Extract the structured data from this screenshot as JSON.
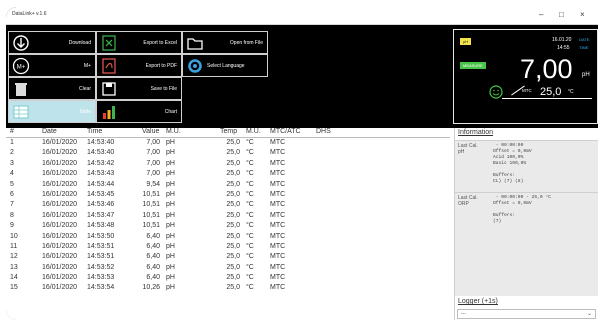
{
  "window": {
    "title": "DataLink+ v.1.6",
    "controls": [
      "–",
      "□",
      "×"
    ]
  },
  "toolbar": {
    "download": "Download",
    "export_excel": "Export to Excel",
    "open_file": "Open from File",
    "mem_plus": "M+",
    "export_pdf": "Export to PDF",
    "select_language": "Select Language",
    "clear": "Clear",
    "save_file": "Save to File",
    "table": "Table",
    "chart": "Chart"
  },
  "display": {
    "mode": "pH",
    "date": "16.01.20",
    "time": "14:55",
    "date_label": "DATE",
    "time_label": "TIME",
    "status": "MEASURE",
    "value": "7,00",
    "unit": "pH",
    "temp_tag": "MTC",
    "temp_value": "25,0",
    "temp_unit": "°C"
  },
  "table": {
    "headers": [
      "#",
      "Date",
      "Time",
      "Value",
      "M.U.",
      "Temp",
      "M.U.",
      "MTC/ATC",
      "DHS"
    ],
    "rows": [
      [
        "1",
        "16/01/2020",
        "14:53:40",
        "7,00",
        "pH",
        "25,0",
        "°C",
        "MTC",
        ""
      ],
      [
        "2",
        "16/01/2020",
        "14:53:40",
        "7,00",
        "pH",
        "25,0",
        "°C",
        "MTC",
        ""
      ],
      [
        "3",
        "16/01/2020",
        "14:53:42",
        "7,00",
        "pH",
        "25,0",
        "°C",
        "MTC",
        ""
      ],
      [
        "4",
        "16/01/2020",
        "14:53:43",
        "7,00",
        "pH",
        "25,0",
        "°C",
        "MTC",
        ""
      ],
      [
        "5",
        "16/01/2020",
        "14:53:44",
        "9,54",
        "pH",
        "25,0",
        "°C",
        "MTC",
        ""
      ],
      [
        "6",
        "16/01/2020",
        "14:53:45",
        "10,51",
        "pH",
        "25,0",
        "°C",
        "MTC",
        ""
      ],
      [
        "7",
        "16/01/2020",
        "14:53:46",
        "10,51",
        "pH",
        "25,0",
        "°C",
        "MTC",
        ""
      ],
      [
        "8",
        "16/01/2020",
        "14:53:47",
        "10,51",
        "pH",
        "25,0",
        "°C",
        "MTC",
        ""
      ],
      [
        "9",
        "16/01/2020",
        "14:53:48",
        "10,51",
        "pH",
        "25,0",
        "°C",
        "MTC",
        ""
      ],
      [
        "10",
        "16/01/2020",
        "14:53:50",
        "6,40",
        "pH",
        "25,0",
        "°C",
        "MTC",
        ""
      ],
      [
        "11",
        "16/01/2020",
        "14:53:51",
        "6,40",
        "pH",
        "25,0",
        "°C",
        "MTC",
        ""
      ],
      [
        "12",
        "16/01/2020",
        "14:53:51",
        "6,40",
        "pH",
        "25,0",
        "°C",
        "MTC",
        ""
      ],
      [
        "13",
        "16/01/2020",
        "14:53:52",
        "6,40",
        "pH",
        "25,0",
        "°C",
        "MTC",
        ""
      ],
      [
        "14",
        "16/01/2020",
        "14:53:53",
        "6,40",
        "pH",
        "25,0",
        "°C",
        "MTC",
        ""
      ],
      [
        "15",
        "16/01/2020",
        "14:53:54",
        "10,26",
        "pH",
        "25,0",
        "°C",
        "MTC",
        ""
      ]
    ]
  },
  "info": {
    "header": "Information",
    "cal_ph_key": "Last Cal.\npH",
    "cal_ph_val": " - 00:00:00\nOffset = 0,0mV\nAcid 100,0%\nBasic 100,0%\n\nBuffers:\nCL) (7) (8)",
    "cal_orp_key": "Last Cal.\nORP",
    "cal_orp_val": " - 00:00:00 - 25,0 °C\nOffset = 0,0mV\n\nBuffers:\n(7)"
  },
  "logger": {
    "header": "Logger (+1s)",
    "value": "---"
  },
  "colors": {
    "accent": "#bfe3ea",
    "status_green": "#49c449",
    "badge_yellow": "#f4e44a",
    "time_blue": "#2ab4f0"
  }
}
